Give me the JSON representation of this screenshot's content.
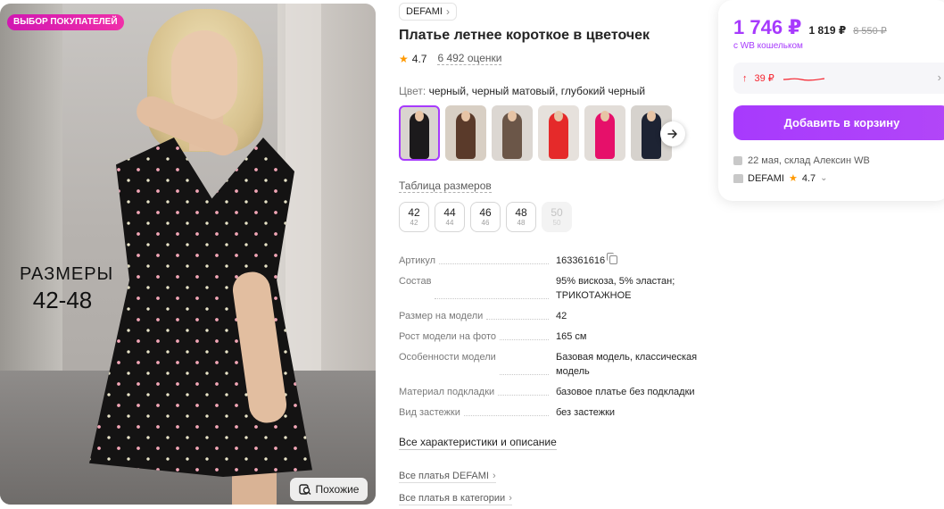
{
  "gallery": {
    "badge": "ВЫБОР ПОКУПАТЕЛЕЙ",
    "overlay_line1": "РАЗМЕРЫ",
    "overlay_line2": "42-48",
    "similar_label": "Похожие"
  },
  "product": {
    "brand": "DEFAMI",
    "title": "Платье летнее короткое в цветочек",
    "rating": "4.7",
    "reviews": "6 492 оценки",
    "color_label": "Цвет:",
    "color_value": "черный, черный матовый, глубокий черный",
    "thumbnails": [
      {
        "name": "black-floral",
        "color": "#1c1a1c"
      },
      {
        "name": "brown-floral",
        "color": "#5a3a2a"
      },
      {
        "name": "leopard",
        "color": "#6b5648"
      },
      {
        "name": "red",
        "color": "#e52a2a"
      },
      {
        "name": "pink",
        "color": "#e6106a"
      },
      {
        "name": "navy-floral",
        "color": "#1d2333"
      }
    ],
    "size_table_link": "Таблица размеров",
    "sizes": [
      {
        "label": "42",
        "sub": "42",
        "available": true
      },
      {
        "label": "44",
        "sub": "44",
        "available": true
      },
      {
        "label": "46",
        "sub": "46",
        "available": true
      },
      {
        "label": "48",
        "sub": "48",
        "available": true
      },
      {
        "label": "50",
        "sub": "50",
        "available": false
      }
    ],
    "specs": [
      {
        "key": "Артикул",
        "value": "163361616"
      },
      {
        "key": "Состав",
        "value": "95% вискоза, 5% эластан; ТРИКОТАЖНОЕ"
      },
      {
        "key": "Размер на модели",
        "value": "42"
      },
      {
        "key": "Рост модели на фото",
        "value": "165 см"
      },
      {
        "key": "Особенности модели",
        "value": "Базовая модель, классическая модель"
      },
      {
        "key": "Материал подкладки",
        "value": "базовое платье без подкладки"
      },
      {
        "key": "Вид застежки",
        "value": "без застежки"
      }
    ],
    "all_characteristics": "Все характеристики и описание",
    "links": [
      "Все платья DEFAMI",
      "Все платья в категории"
    ]
  },
  "price_card": {
    "price": "1 746 ₽",
    "price_alt": "1 819 ₽",
    "price_old": "8 550 ₽",
    "wallet_note": "с WB кошельком",
    "price_history": "39 ₽",
    "add_to_cart": "Добавить в корзину",
    "delivery": "22 мая, склад Алексин WB",
    "seller_name": "DEFAMI",
    "seller_rating": "4.7"
  },
  "colors": {
    "accent": "#a73afd",
    "badge_pink": "#e91eab",
    "star": "#ff9900",
    "price_up": "#f5222d"
  }
}
